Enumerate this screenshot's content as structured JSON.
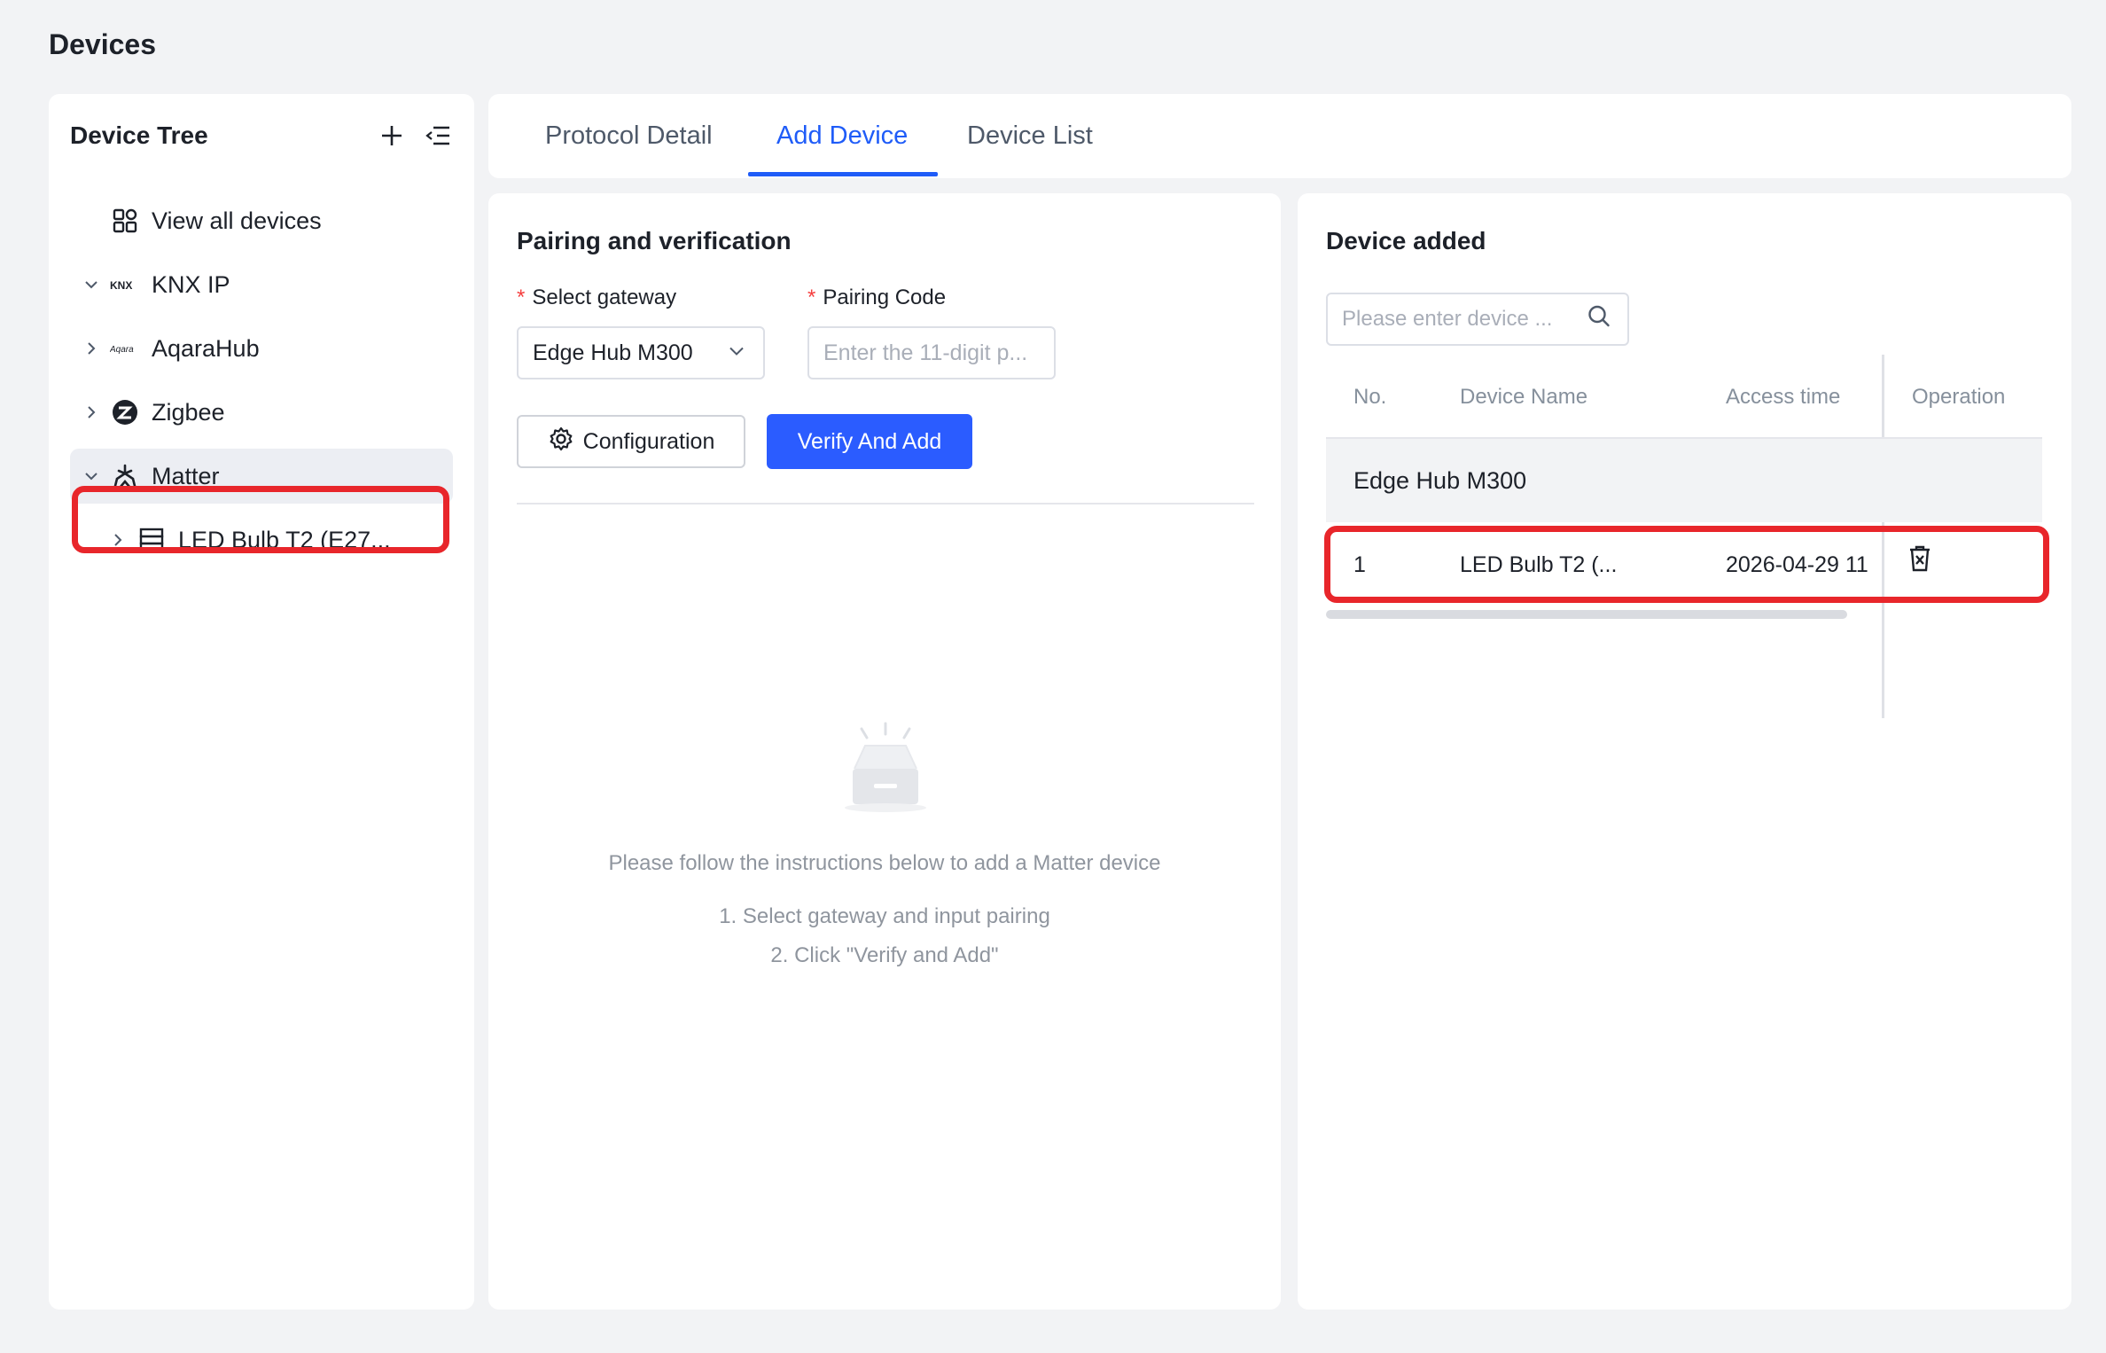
{
  "page": {
    "title": "Devices"
  },
  "colors": {
    "accent": "#1f5cf8",
    "primary_button": "#2b5cff",
    "highlight": "#e8262b",
    "required": "#f53f3f"
  },
  "device_tree": {
    "title": "Device Tree",
    "tools": [
      {
        "icon": "plus-icon"
      },
      {
        "icon": "collapse-menu-icon"
      }
    ],
    "items": [
      {
        "label": "View all devices",
        "icon": "grid-icon"
      },
      {
        "label": "KNX IP",
        "icon": "knx-logo-icon",
        "expanded": true
      },
      {
        "label": "AqaraHub",
        "icon": "aqara-logo-icon",
        "expanded": false
      },
      {
        "label": "Zigbee",
        "icon": "zigbee-logo-icon",
        "expanded": false
      },
      {
        "label": "Matter",
        "icon": "matter-logo-icon",
        "expanded": true,
        "selected": true
      },
      {
        "label": "LED Bulb T2 (E27...",
        "icon": "server-icon",
        "expanded": false
      }
    ]
  },
  "tabs": [
    {
      "label": "Protocol Detail"
    },
    {
      "label": "Add Device",
      "active": true
    },
    {
      "label": "Device List"
    }
  ],
  "pairing": {
    "title": "Pairing and verification",
    "gateway_label": "Select gateway",
    "gateway_value": "Edge Hub M300",
    "code_label": "Pairing Code",
    "code_placeholder": "Enter the 11-digit p...",
    "config_button": "Configuration",
    "verify_button": "Verify And Add",
    "empty_hint": "Please follow the instructions below to add a Matter device",
    "steps": [
      "1. Select gateway and input pairing",
      "2. Click \"Verify and Add\""
    ]
  },
  "device_added": {
    "title": "Device added",
    "search_placeholder": "Please enter device ...",
    "columns": [
      "No.",
      "Device Name",
      "Access time",
      "Operation"
    ],
    "group": "Edge Hub M300",
    "rows": [
      {
        "no": "1",
        "name": "LED Bulb T2 (...",
        "time": "2026-04-29 11",
        "action_icon": "delete-icon"
      }
    ]
  }
}
